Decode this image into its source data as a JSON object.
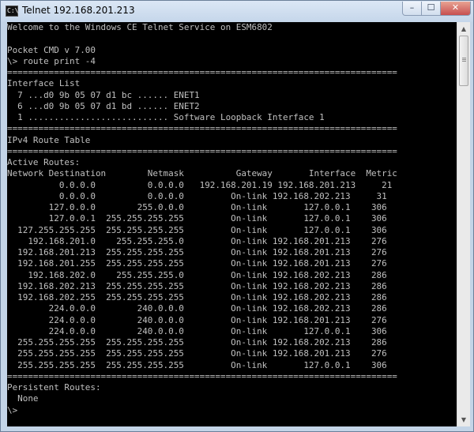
{
  "window": {
    "title": "Telnet 192.168.201.213",
    "icon_name": "cmd-console-icon",
    "icon_glyph": "C:\\",
    "controls": {
      "minimize": "–",
      "maximize": "☐",
      "close": "✕"
    }
  },
  "terminal": {
    "lines": [
      "Welcome to the Windows CE Telnet Service on ESM6802",
      "",
      "Pocket CMD v 7.00",
      "\\> route print -4",
      "===========================================================================",
      "Interface List",
      "  7 ...d0 9b 05 07 d1 bc ...... ENET1",
      "  6 ...d0 9b 05 07 d1 bd ...... ENET2",
      "  1 ........................... Software Loopback Interface 1",
      "===========================================================================",
      "IPv4 Route Table",
      "===========================================================================",
      "Active Routes:",
      "Network Destination        Netmask          Gateway       Interface  Metric",
      "          0.0.0.0          0.0.0.0   192.168.201.19 192.168.201.213     21",
      "          0.0.0.0          0.0.0.0         On-link 192.168.202.213     31",
      "        127.0.0.0        255.0.0.0         On-link       127.0.0.1    306",
      "        127.0.0.1  255.255.255.255         On-link       127.0.0.1    306",
      "  127.255.255.255  255.255.255.255         On-link       127.0.0.1    306",
      "    192.168.201.0    255.255.255.0         On-link 192.168.201.213    276",
      "  192.168.201.213  255.255.255.255         On-link 192.168.201.213    276",
      "  192.168.201.255  255.255.255.255         On-link 192.168.201.213    276",
      "    192.168.202.0    255.255.255.0         On-link 192.168.202.213    286",
      "  192.168.202.213  255.255.255.255         On-link 192.168.202.213    286",
      "  192.168.202.255  255.255.255.255         On-link 192.168.202.213    286",
      "        224.0.0.0        240.0.0.0         On-link 192.168.202.213    286",
      "        224.0.0.0        240.0.0.0         On-link 192.168.201.213    276",
      "        224.0.0.0        240.0.0.0         On-link       127.0.0.1    306",
      "  255.255.255.255  255.255.255.255         On-link 192.168.202.213    286",
      "  255.255.255.255  255.255.255.255         On-link 192.168.201.213    276",
      "  255.255.255.255  255.255.255.255         On-link       127.0.0.1    306",
      "===========================================================================",
      "Persistent Routes:",
      "  None",
      "\\>"
    ]
  },
  "scrollbar": {
    "up_arrow": "▲",
    "down_arrow": "▼"
  },
  "colors": {
    "terminal_bg": "#000000",
    "terminal_fg": "#c0c0c0",
    "close_button": "#c75050"
  }
}
